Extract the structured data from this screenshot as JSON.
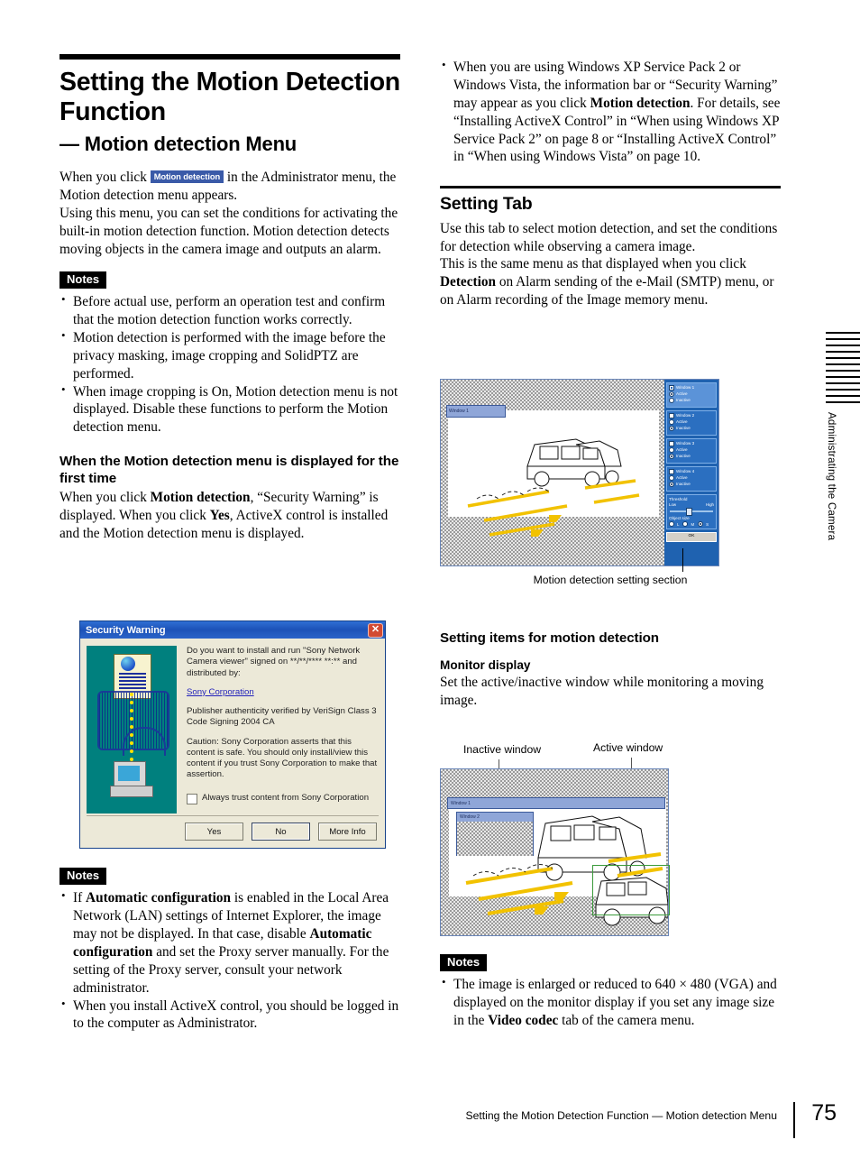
{
  "page": {
    "number": "75",
    "footer_title": "Setting the Motion Detection Function — Motion detection Menu",
    "side_tab": "Administrating the Camera"
  },
  "left": {
    "title": "Setting the Motion Detection Function",
    "subtitle": "— Motion detection Menu",
    "chip_label": "Motion detection",
    "intro_1a": "When you click",
    "intro_1b": "in the Administrator menu, the Motion detection menu appears.",
    "intro_2": "Using this menu, you can set the conditions for activating the built-in motion detection function. Motion detection detects moving objects in the camera image and outputs an alarm.",
    "notes_label": "Notes",
    "notes": [
      "Before actual use, perform an operation test and confirm that the motion detection function works correctly.",
      "Motion detection is performed with the image before the privacy masking, image cropping and SolidPTZ are performed.",
      "When image cropping is On, Motion detection menu is not displayed. Disable these functions to perform the Motion detection menu."
    ],
    "subheading": "When the Motion detection menu is displayed for the first time",
    "first_time_a": "When you click ",
    "first_time_b": "Motion detection",
    "first_time_c": ", “Security Warning” is displayed. When you click ",
    "first_time_d": "Yes",
    "first_time_e": ", ActiveX control is installed and the Motion detection menu is displayed.",
    "notes2_label": "Notes",
    "notes2": [
      {
        "a": "If ",
        "b": "Automatic configuration",
        "c": " is enabled in the Local Area Network (LAN) settings of Internet Explorer, the image may not be displayed. In that case, disable ",
        "d": "Automatic configuration",
        "e": " and set the Proxy server manually. For the setting of the Proxy server, consult your network administrator."
      },
      {
        "a": "When you install ActiveX control, you should be logged in to the computer as Administrator.",
        "b": "",
        "c": "",
        "d": "",
        "e": ""
      }
    ]
  },
  "dialog": {
    "title": "Security Warning",
    "close_glyph": "✕",
    "question": "Do you want to install and run \"Sony Network Camera viewer\" signed on **/**/**** **:** and distributed by:",
    "link": "Sony Corporation",
    "publisher": "Publisher authenticity verified by VeriSign Class 3 Code Signing 2004 CA",
    "caution": "Caution: Sony Corporation asserts that this content is safe. You should only install/view this content if you trust Sony Corporation to make that assertion.",
    "checkbox_label": "Always trust content from Sony Corporation",
    "btn_yes": "Yes",
    "btn_no": "No",
    "btn_more": "More Info"
  },
  "right": {
    "top_note": {
      "a": "When you are using Windows XP Service Pack 2 or Windows Vista, the information bar or “Security Warning” may appear as you click ",
      "b": "Motion detection",
      "c": ". For details, see “Installing ActiveX Control” in “When using Windows XP Service Pack 2” on page 8 or “Installing ActiveX Control” in “When using Windows Vista” on page 10."
    },
    "section_title": "Setting Tab",
    "setting_body_1": "Use this tab to select motion detection, and set the conditions for detection while observing a camera image.",
    "setting_body_2a": "This is the same menu as that displayed when you click ",
    "setting_body_2b": "Detection",
    "setting_body_2c": " on Alarm sending of the e-Mail (SMTP) menu, or on Alarm recording of the Image memory menu.",
    "fig1_caption": "Motion detection setting section",
    "items_heading": "Setting items for motion detection",
    "monitor_heading": "Monitor display",
    "monitor_body": "Set the active/inactive window while monitoring a moving image.",
    "fig2_label_inactive": "Inactive window",
    "fig2_label_active": "Active window",
    "notes3_label": "Notes",
    "notes3": {
      "a": "The image is enlarged or reduced to 640 × 480 (VGA) and displayed on the monitor display if  you set any image size in the ",
      "b": "Video codec",
      "c": " tab of the camera menu."
    }
  },
  "figure1": {
    "windows": [
      {
        "name": "Window 1",
        "active": "Active",
        "inactive": "Inactive",
        "selected": true
      },
      {
        "name": "Window 2",
        "active": "Active",
        "inactive": "Inactive",
        "selected": false
      },
      {
        "name": "Window 3",
        "active": "Active",
        "inactive": "Inactive",
        "selected": false
      },
      {
        "name": "Window 4",
        "active": "Active",
        "inactive": "Inactive",
        "selected": false
      }
    ],
    "threshold_label": "Threshold",
    "threshold_low": "Low",
    "threshold_high": "High",
    "objectsize_label": "Object size",
    "size_l": "L",
    "size_m": "M",
    "size_s": "S",
    "ok_label": "OK",
    "scene_window_label": "Window 1"
  },
  "figure2": {
    "window1_label": "Window 1",
    "window2_label": "Window 2"
  }
}
